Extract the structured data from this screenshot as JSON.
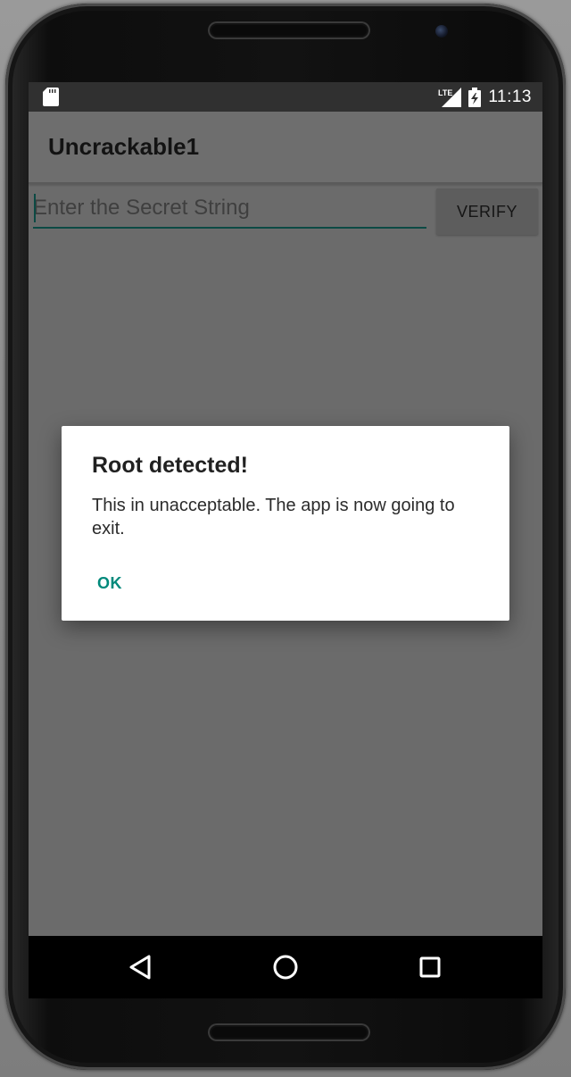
{
  "status_bar": {
    "time": "11:13",
    "network_label": "LTE",
    "icons": [
      "sd-card-icon",
      "lte-signal-icon",
      "battery-charging-icon"
    ]
  },
  "app_bar": {
    "title": "Uncrackable1"
  },
  "form": {
    "input_placeholder": "Enter the Secret String",
    "input_value": "",
    "verify_label": "VERIFY"
  },
  "dialog": {
    "title": "Root detected!",
    "message": "This in unacceptable. The app is now going to exit.",
    "ok_label": "OK"
  },
  "nav_bar": {
    "icons": [
      "back-triangle-icon",
      "home-circle-icon",
      "recents-square-icon"
    ]
  },
  "colors": {
    "accent": "#00897b",
    "scrim_background": "#6b6b6b",
    "status_bar": "#303030",
    "dialog_background": "#ffffff"
  }
}
